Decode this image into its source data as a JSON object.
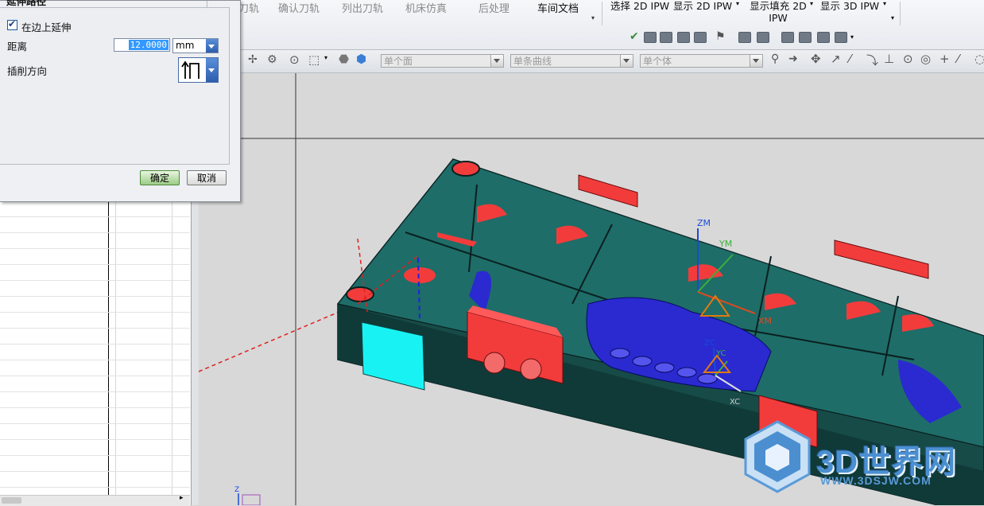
{
  "ribbon": {
    "tabs": [
      "刀轨",
      "确认刀轨",
      "列出刀轨",
      "机床仿真",
      "后处理",
      "车间文档"
    ],
    "ipw": {
      "select_2d": "选择 2D IPW",
      "show_2d": "显示 2D IPW",
      "show_fill_2d": "显示填充 2D IPW",
      "show_3d": "显示 3D IPW"
    }
  },
  "selection_bar": {
    "face_filter": "单个面",
    "curve_filter": "单条曲线",
    "body_filter": "单个体"
  },
  "dialog": {
    "partial_title": "延伸路径",
    "extend_on_edge_label": "在边上延伸",
    "extend_on_edge_checked": true,
    "distance_label": "距离",
    "distance_value": "12.0000",
    "distance_unit": "mm",
    "cut_direction_label": "插削方向",
    "ok_label": "确定",
    "cancel_label": "取消"
  },
  "viewport": {
    "axes": {
      "zm": "ZM",
      "ym": "YM",
      "xm": "XM",
      "zc": "ZC",
      "yc": "YC",
      "xc": "XC",
      "z": "Z"
    }
  },
  "watermark": {
    "brand": "3D世界网",
    "url": "WWW.3DSJW.COM"
  },
  "colors": {
    "part_teal": "#1f6f6a",
    "part_red": "#f23c3c",
    "pocket_blue": "#2a2ad0",
    "highlight_cyan": "#19f2f2",
    "ok_green": "#9ccc86"
  }
}
